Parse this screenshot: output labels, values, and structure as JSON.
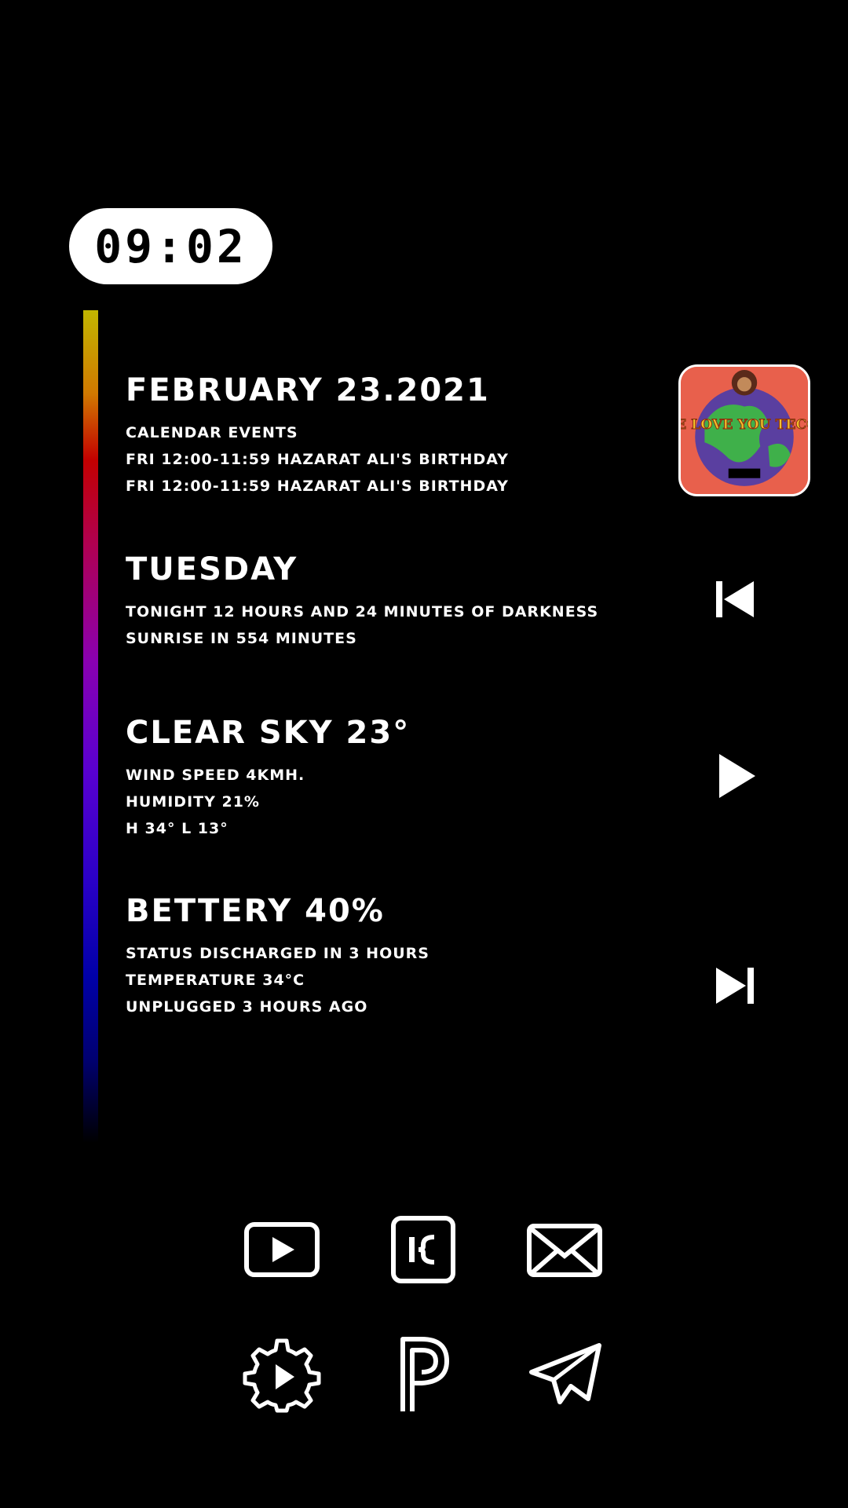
{
  "clock": {
    "time": "09:02"
  },
  "date_section": {
    "title": "FEBRUARY 23.2021",
    "lines": [
      "CALENDAR EVENTS",
      "FRI 12:00-11:59 HAZARAT ALI'S BIRTHDAY",
      "FRI 12:00-11:59 HAZARAT ALI'S BIRTHDAY"
    ]
  },
  "day_section": {
    "title": "TUESDAY",
    "lines": [
      "TONIGHT 12 HOURS AND 24 MINUTES OF DARKNESS",
      "SUNRISE IN 554 MINUTES"
    ]
  },
  "weather_section": {
    "title": "CLEAR SKY 23°",
    "lines": [
      "WIND SPEED 4KMH.",
      "HUMIDITY 21%",
      "H 34° L 13°"
    ]
  },
  "battery_section": {
    "title": "BETTERY 40%",
    "lines": [
      "STATUS DISCHARGED IN 3 HOURS",
      "TEMPERATURE 34°C",
      "UNPLUGGED 3 HOURS AGO"
    ]
  },
  "album": {
    "cover_text": "WE LOVE YOU TECCA",
    "icon": "album-art"
  },
  "media_controls": [
    "previous-icon",
    "play-icon",
    "next-icon"
  ],
  "apps": [
    "youtube-icon",
    "klwp-icon",
    "mail-icon",
    "settings-play-icon",
    "pinterest-p-icon",
    "telegram-icon"
  ],
  "colors": {
    "background": "#000000",
    "foreground": "#ffffff",
    "album_bg": "#e8604c"
  }
}
